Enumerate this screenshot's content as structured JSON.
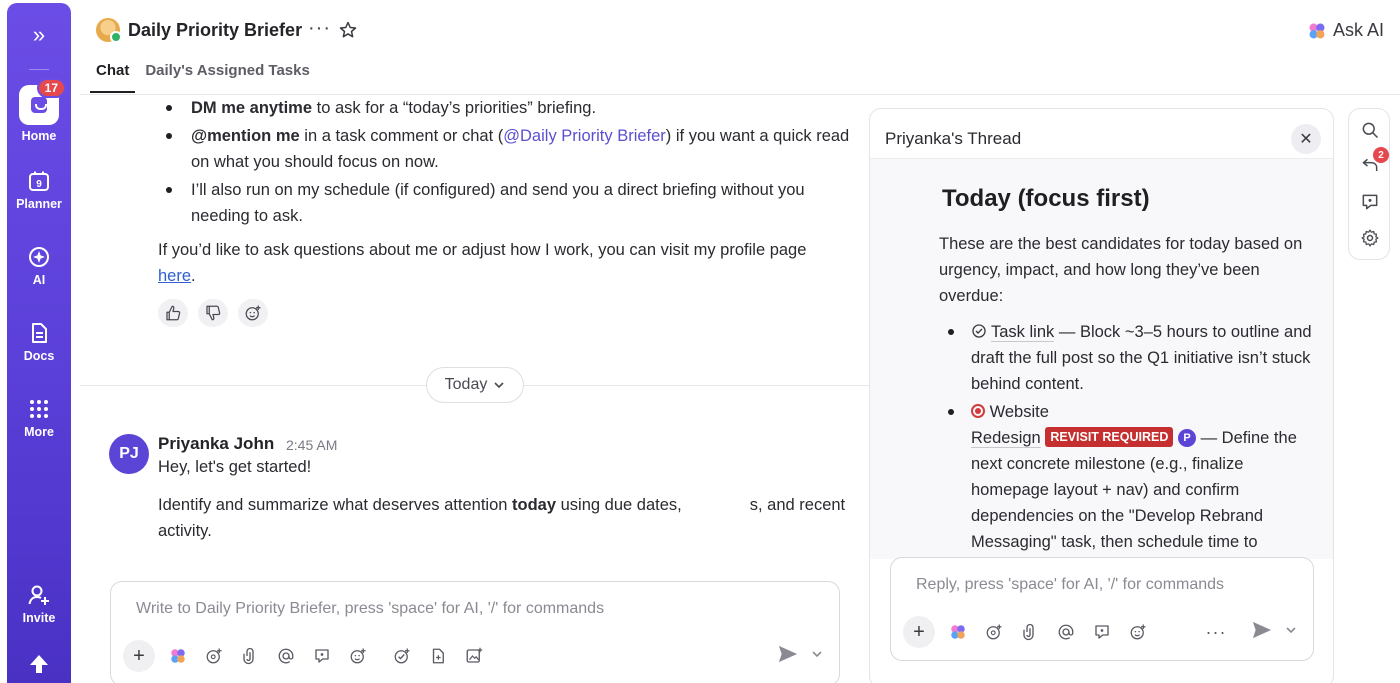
{
  "nav": {
    "home_badge": "17",
    "items": [
      {
        "label": "Home"
      },
      {
        "label": "Planner"
      },
      {
        "label": "AI"
      },
      {
        "label": "Docs"
      },
      {
        "label": "More"
      },
      {
        "label": "Invite"
      }
    ],
    "planner_day": "9"
  },
  "header": {
    "title": "Daily Priority Briefer",
    "more": "···",
    "ask_ai": "Ask AI",
    "tabs": [
      {
        "label": "Chat",
        "active": true
      },
      {
        "label": "Daily's Assigned Tasks",
        "active": false
      }
    ]
  },
  "chat": {
    "bullets": [
      {
        "strong": "DM me anytime",
        "rest": " to ask for a “today’s priorities” briefing."
      },
      {
        "strong": "@mention me",
        "rest_a": " in a task comment or chat (",
        "mention": "@Daily Priority Briefer",
        "rest_b": ") if you want a quick read on what you should focus on now."
      },
      {
        "text": "I’ll also run on my schedule (if configured) and send you a direct briefing without you needing to ask."
      }
    ],
    "profile_text": "If you’d like to ask questions about me or adjust how I work, you can visit my profile page ",
    "profile_link": "here",
    "profile_end": ".",
    "divider_label": "Today",
    "message": {
      "avatar_initials": "PJ",
      "author": "Priyanka John",
      "time": "2:45 AM",
      "line1": "Hey, let's get started!",
      "line2_a": "Identify and summarize what deserves attention ",
      "line2_bold": "today",
      "line2_b": " using due dates,",
      "line2_c": "s, and recent activity."
    },
    "composer_placeholder": "Write to Daily Priority Briefer, press 'space' for AI, '/' for commands"
  },
  "thread": {
    "title": "Priyanka's Thread",
    "heading": "Today (focus first)",
    "intro": "These are the best candidates for today based on urgency, impact, and how long they’ve been overdue:",
    "item1_link": "Task link",
    "item1_text": " — Block ~3–5 hours to outline and draft the full post so the Q1 initiative isn’t stuck behind content.",
    "item2_link_a": "Website",
    "item2_link_b": "Redesign",
    "item2_badge": "REVISIT REQUIRED",
    "item2_avatar": "P",
    "item2_text": " — Define the next concrete milestone (e.g., finalize homepage layout + nav) and confirm dependencies on the \"Develop Rebrand Messaging\" task, then schedule time to",
    "reply_placeholder": "Reply, press 'space' for AI, '/' for commands",
    "more": "···"
  },
  "mini_rail": {
    "badge": "2"
  }
}
